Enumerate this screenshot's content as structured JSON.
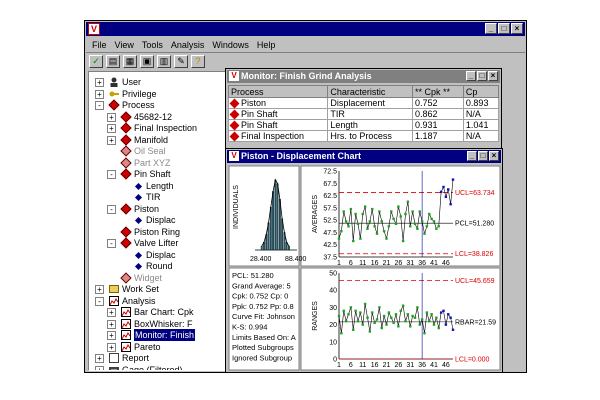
{
  "app": {
    "window_buttons": [
      "_",
      "□",
      "×"
    ]
  },
  "menu": {
    "file": "File",
    "view": "View",
    "tools": "Tools",
    "analysis": "Analysis",
    "windows": "Windows",
    "help": "Help"
  },
  "tree": {
    "items": [
      {
        "label": "User",
        "exp": "+",
        "icon": "user-icon"
      },
      {
        "label": "Privilege",
        "exp": "+",
        "icon": "key-icon"
      },
      {
        "label": "Process",
        "exp": "-",
        "icon": "process-icon"
      },
      {
        "label": "45682-12",
        "exp": "+",
        "icon": "process-icon"
      },
      {
        "label": "Final Inspection",
        "exp": "+",
        "icon": "process-icon"
      },
      {
        "label": "Manifold",
        "exp": "+",
        "icon": "process-icon"
      },
      {
        "label": "Oil Seal",
        "exp": "",
        "icon": "process-icon-grey"
      },
      {
        "label": "Part XYZ",
        "exp": "",
        "icon": "process-icon-grey"
      },
      {
        "label": "Pin Shaft",
        "exp": "-",
        "icon": "process-icon"
      },
      {
        "label": "Length",
        "exp": "",
        "icon": "characteristic-icon"
      },
      {
        "label": "TIR",
        "exp": "",
        "icon": "characteristic-icon"
      },
      {
        "label": "Piston",
        "exp": "-",
        "icon": "process-icon"
      },
      {
        "label": "Displac",
        "exp": "",
        "icon": "characteristic-icon"
      },
      {
        "label": "Piston Ring",
        "exp": "",
        "icon": "process-icon"
      },
      {
        "label": "Valve Lifter",
        "exp": "-",
        "icon": "process-icon"
      },
      {
        "label": "Displac",
        "exp": "",
        "icon": "characteristic-icon"
      },
      {
        "label": "Round",
        "exp": "",
        "icon": "characteristic-icon"
      },
      {
        "label": "Widget",
        "exp": "",
        "icon": "process-icon-grey"
      },
      {
        "label": "Work Set",
        "exp": "+",
        "icon": "folder-icon"
      },
      {
        "label": "Analysis",
        "exp": "-",
        "icon": "analysis-icon"
      },
      {
        "label": "Bar Chart: Cpk",
        "exp": "+",
        "icon": "chart-icon"
      },
      {
        "label": "BoxWhisker: F",
        "exp": "+",
        "icon": "chart-icon"
      },
      {
        "label": "Monitor: Finish",
        "exp": "+",
        "icon": "chart-icon",
        "selected": true
      },
      {
        "label": "Pareto",
        "exp": "+",
        "icon": "chart-icon"
      },
      {
        "label": "Report",
        "exp": "+",
        "icon": "report-icon"
      },
      {
        "label": "Gage (Filtered)",
        "exp": "+",
        "icon": "gage-icon"
      }
    ]
  },
  "monitor": {
    "title": "Monitor: Finish Grind Analysis",
    "columns": [
      "Process",
      "Characteristic",
      "** Cpk **",
      "Cp"
    ],
    "rows": [
      [
        "Piston",
        "Displacement",
        "0.752",
        "0.893"
      ],
      [
        "Pin Shaft",
        "TIR",
        "0.862",
        "N/A"
      ],
      [
        "Pin Shaft",
        "Length",
        "0.931",
        "1.041"
      ],
      [
        "Final Inspection",
        "Hrs. to Process",
        "1.187",
        "N/A"
      ]
    ]
  },
  "chart": {
    "title": "Piston - Displacement Chart",
    "histogram": {
      "ylabel": "INDIVIDUALS",
      "xmin_label": "28.400",
      "xmax_label": "88.400"
    },
    "stats": [
      "PCL: 51.280",
      "Grand Average: 5",
      "Cpk: 0.752  Cp: 0",
      "Ppk: 0.752  Pp: 0.8",
      "Curve Fit: Johnson",
      "K-S: 0.994",
      "Limits Based On: A",
      "Plotted Subgroups",
      "Ignored Subgroup"
    ]
  },
  "chart_data": [
    {
      "type": "line",
      "title": "",
      "ylabel": "AVERAGES",
      "xlabel": "",
      "x_ticks": [
        "1",
        "6",
        "11",
        "16",
        "21",
        "26",
        "31",
        "36",
        "41",
        "46"
      ],
      "y_ticks": [
        "37.5",
        "42.5",
        "47.5",
        "52.5",
        "57.5",
        "62.5",
        "67.5",
        "72.5"
      ],
      "ylim": [
        37.5,
        72.5
      ],
      "xlim": [
        1,
        49
      ],
      "ucl": {
        "label": "UCL=63.734",
        "value": 63.734
      },
      "pcl": {
        "label": "PCL=51.280",
        "value": 51.28
      },
      "lcl": {
        "label": "LCL=38.826",
        "value": 38.826
      },
      "values": [
        45,
        48,
        56,
        52,
        50,
        57,
        44,
        55,
        51,
        45,
        55,
        58,
        49,
        52,
        57,
        50,
        47,
        56,
        52,
        48,
        45,
        50,
        56,
        53,
        51,
        58,
        54,
        44,
        55,
        60,
        50,
        56,
        51,
        49,
        56,
        52,
        47,
        50,
        55,
        53,
        52,
        49,
        50,
        64,
        66,
        62,
        65,
        59,
        69
      ]
    },
    {
      "type": "line",
      "title": "",
      "ylabel": "RANGES",
      "xlabel": "",
      "x_ticks": [
        "1",
        "6",
        "11",
        "16",
        "21",
        "26",
        "31",
        "36",
        "41",
        "46"
      ],
      "y_ticks": [
        "0",
        "10",
        "20",
        "30",
        "40",
        "50"
      ],
      "ylim": [
        0,
        50
      ],
      "xlim": [
        1,
        49
      ],
      "ucl": {
        "label": "UCL=45.659",
        "value": 45.659
      },
      "pcl": {
        "label": "RBAR=21.59",
        "value": 21.59
      },
      "lcl": {
        "label": "LCL=0.000",
        "value": 0
      },
      "values": [
        25,
        15,
        28,
        22,
        26,
        30,
        17,
        28,
        22,
        27,
        20,
        32,
        24,
        16,
        27,
        21,
        23,
        30,
        18,
        25,
        20,
        27,
        24,
        21,
        26,
        19,
        28,
        31,
        22,
        26,
        19,
        25,
        24,
        30,
        20,
        23,
        15,
        27,
        22,
        26,
        20,
        24,
        18,
        27,
        28,
        20,
        26,
        24,
        17
      ]
    },
    {
      "type": "bar",
      "title": "",
      "ylabel": "INDIVIDUALS",
      "xlabel": "",
      "x_ticks": [
        "28.400",
        "88.400"
      ],
      "values": [
        2,
        4,
        8,
        14,
        22,
        30,
        36,
        34,
        26,
        16,
        9,
        4,
        2
      ]
    }
  ]
}
